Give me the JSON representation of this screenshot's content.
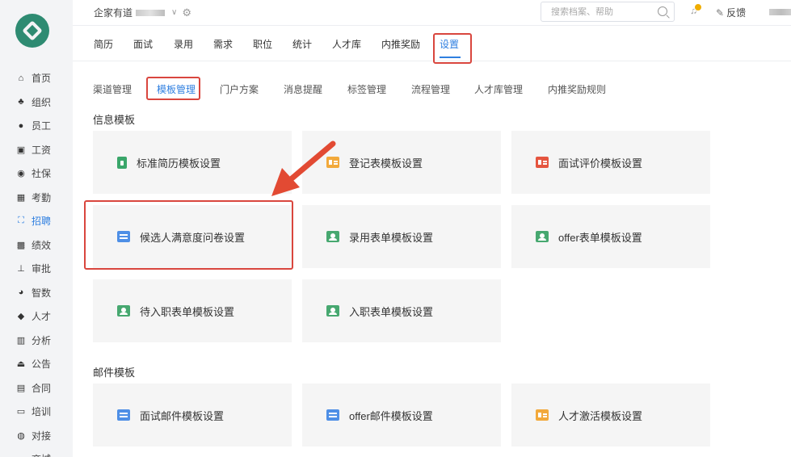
{
  "header": {
    "company": "企家有道",
    "search_placeholder": "搜索档案、帮助",
    "feedback": "反馈"
  },
  "sidebar": {
    "items": [
      {
        "label": "首页",
        "icon": "home-icon"
      },
      {
        "label": "组织",
        "icon": "org-icon"
      },
      {
        "label": "员工",
        "icon": "user-icon"
      },
      {
        "label": "工资",
        "icon": "salary-icon"
      },
      {
        "label": "社保",
        "icon": "shield-icon"
      },
      {
        "label": "考勤",
        "icon": "calendar-icon"
      },
      {
        "label": "招聘",
        "icon": "recruit-icon"
      },
      {
        "label": "绩效",
        "icon": "chart-icon"
      },
      {
        "label": "审批",
        "icon": "stamp-icon"
      },
      {
        "label": "智数",
        "icon": "pie-icon"
      },
      {
        "label": "人才",
        "icon": "graduation-icon"
      },
      {
        "label": "分析",
        "icon": "analysis-icon"
      },
      {
        "label": "公告",
        "icon": "announce-icon"
      },
      {
        "label": "合同",
        "icon": "contract-icon"
      },
      {
        "label": "培训",
        "icon": "training-icon"
      },
      {
        "label": "对接",
        "icon": "connect-icon"
      },
      {
        "label": "商城",
        "icon": "shop-icon"
      }
    ],
    "active": "招聘"
  },
  "top_tabs": [
    "简历",
    "面试",
    "录用",
    "需求",
    "职位",
    "统计",
    "人才库",
    "内推奖励",
    "设置"
  ],
  "top_tab_active": "设置",
  "sub_tabs": [
    "渠道管理",
    "模板管理",
    "门户方案",
    "消息提醒",
    "标签管理",
    "流程管理",
    "人才库管理",
    "内推奖励规则"
  ],
  "sub_tab_active": "模板管理",
  "sections": {
    "info": {
      "title": "信息模板",
      "cards": [
        {
          "label": "标准简历模板设置",
          "icon": "clipboard-icon"
        },
        {
          "label": "登记表模板设置",
          "icon": "id-card-icon"
        },
        {
          "label": "面试评价模板设置",
          "icon": "id-card-icon"
        },
        {
          "label": "候选人满意度问卷设置",
          "icon": "form-icon"
        },
        {
          "label": "录用表单模板设置",
          "icon": "contact-card-icon"
        },
        {
          "label": "offer表单模板设置",
          "icon": "contact-card-icon"
        },
        {
          "label": "待入职表单模板设置",
          "icon": "contact-card-icon"
        },
        {
          "label": "入职表单模板设置",
          "icon": "contact-card-icon"
        }
      ]
    },
    "mail": {
      "title": "邮件模板",
      "cards": [
        {
          "label": "面试邮件模板设置",
          "icon": "form-icon"
        },
        {
          "label": "offer邮件模板设置",
          "icon": "form-icon"
        },
        {
          "label": "人才激活模板设置",
          "icon": "id-card-icon"
        }
      ]
    }
  },
  "colors": {
    "accent": "#2f7fe0",
    "highlight": "#d9463e",
    "logo": "#2e8b72"
  }
}
